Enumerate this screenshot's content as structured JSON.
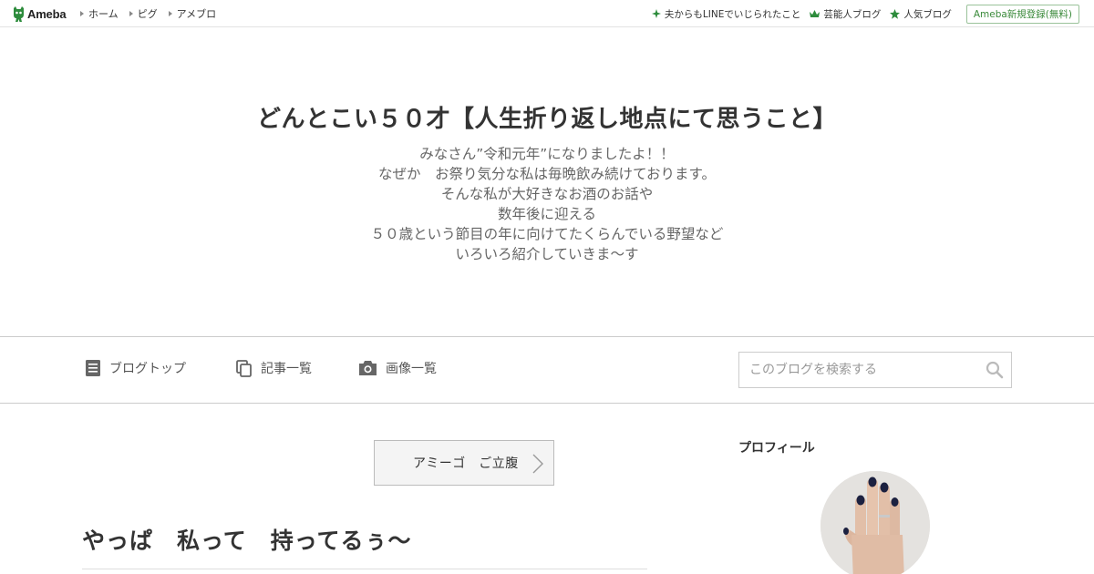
{
  "topbar": {
    "logo_text": "Ameba",
    "nav_left": [
      "ホーム",
      "ピグ",
      "アメブロ"
    ],
    "nav_right": [
      {
        "label": "夫からもLINEでいじられたこと",
        "icon": "sparkle-icon"
      },
      {
        "label": "芸能人ブログ",
        "icon": "crown-icon"
      },
      {
        "label": "人気ブログ",
        "icon": "star-icon"
      }
    ],
    "signup_label": "Ameba新規登録(無料)"
  },
  "header": {
    "title": "どんとこい５０才【人生折り返し地点にて思うこと】",
    "description_lines": [
      "みなさん”令和元年”になりましたよ！！",
      "なぜか　お祭り気分な私は毎晩飲み続けております。",
      "そんな私が大好きなお酒のお話や",
      "数年後に迎える",
      "５０歳という節目の年に向けてたくらんでいる野望など",
      "いろいろ紹介していきま～す"
    ]
  },
  "navbar": {
    "items": [
      {
        "label": "ブログトップ",
        "icon": "document-icon"
      },
      {
        "label": "記事一覧",
        "icon": "copy-icon"
      },
      {
        "label": "画像一覧",
        "icon": "camera-icon"
      }
    ],
    "search_placeholder": "このブログを検索する"
  },
  "main": {
    "theme_button": "アミーゴ　ご立腹",
    "entry_title": "やっぱ　私って　持ってるぅ～"
  },
  "sidebar": {
    "profile_title": "プロフィール"
  },
  "colors": {
    "ameba_green": "#2d8c3c",
    "text": "#333333",
    "muted": "#666666",
    "border": "#cccccc"
  }
}
